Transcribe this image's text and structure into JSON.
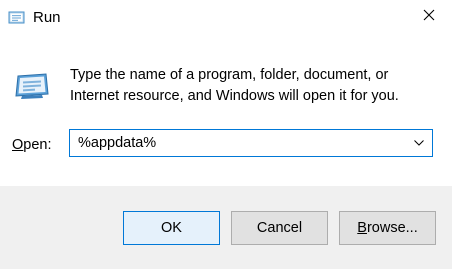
{
  "window": {
    "title": "Run",
    "title_icon": "run-dialog-icon",
    "close_icon": "close-icon"
  },
  "content": {
    "icon": "run-program-icon",
    "description": "Type the name of a program, folder, document, or Internet resource, and Windows will open it for you.",
    "open_label_prefix": "",
    "open_label_accel": "O",
    "open_label_rest": "pen:",
    "open_value": "%appdata%",
    "dropdown_icon": "chevron-down-icon"
  },
  "buttons": {
    "ok": "OK",
    "cancel": "Cancel",
    "browse_accel": "B",
    "browse_rest": "rowse..."
  },
  "colors": {
    "accent": "#0078d7",
    "footer_bg": "#f0f0f0",
    "button_bg": "#e1e1e1",
    "default_button_bg": "#e5f1fb"
  }
}
